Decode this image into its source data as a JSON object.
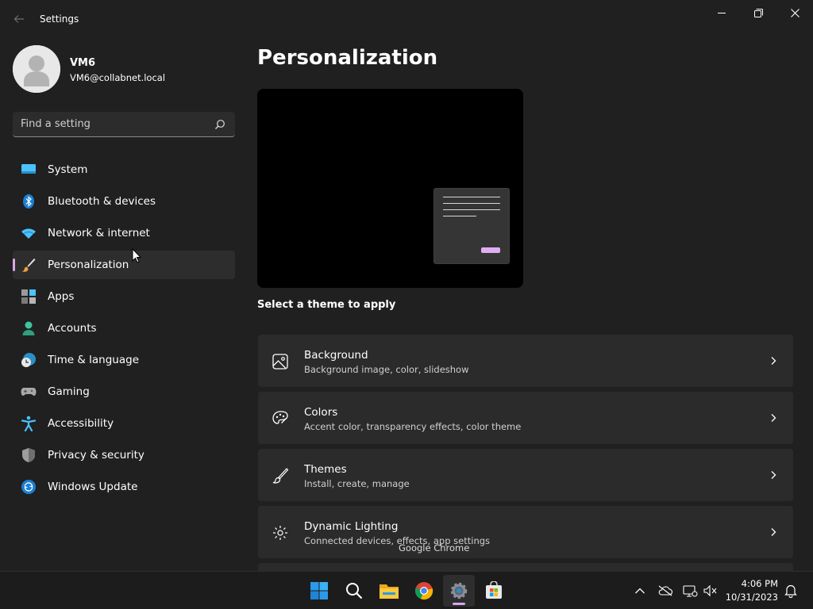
{
  "window": {
    "title": "Settings",
    "back_icon": "back-arrow-icon",
    "controls": [
      "minimize",
      "restore",
      "close"
    ]
  },
  "profile": {
    "name": "VM6",
    "email": "VM6@collabnet.local"
  },
  "search": {
    "placeholder": "Find a setting",
    "value": ""
  },
  "sidebar": {
    "items": [
      {
        "label": "System",
        "icon": "monitor-icon",
        "active": false
      },
      {
        "label": "Bluetooth & devices",
        "icon": "bluetooth-icon",
        "active": false
      },
      {
        "label": "Network & internet",
        "icon": "wifi-icon",
        "active": false
      },
      {
        "label": "Personalization",
        "icon": "paintbrush-icon",
        "active": true
      },
      {
        "label": "Apps",
        "icon": "apps-icon",
        "active": false
      },
      {
        "label": "Accounts",
        "icon": "person-icon",
        "active": false
      },
      {
        "label": "Time & language",
        "icon": "globe-clock-icon",
        "active": false
      },
      {
        "label": "Gaming",
        "icon": "gamepad-icon",
        "active": false
      },
      {
        "label": "Accessibility",
        "icon": "accessibility-icon",
        "active": false
      },
      {
        "label": "Privacy & security",
        "icon": "shield-icon",
        "active": false
      },
      {
        "label": "Windows Update",
        "icon": "update-icon",
        "active": false
      }
    ],
    "accent_color": "#d9a5eb"
  },
  "main": {
    "title": "Personalization",
    "theme_caption": "Select a theme to apply",
    "cards": [
      {
        "title": "Background",
        "subtitle": "Background image, color, slideshow",
        "icon": "image-icon"
      },
      {
        "title": "Colors",
        "subtitle": "Accent color, transparency effects, color theme",
        "icon": "palette-icon"
      },
      {
        "title": "Themes",
        "subtitle": "Install, create, manage",
        "icon": "brush-icon"
      },
      {
        "title": "Dynamic Lighting",
        "subtitle": "Connected devices, effects, app settings",
        "icon": "lighting-icon"
      }
    ]
  },
  "tooltip": "Google Chrome",
  "taskbar": {
    "apps": [
      {
        "name": "Start",
        "icon": "windows-start-icon"
      },
      {
        "name": "Search",
        "icon": "search-icon"
      },
      {
        "name": "File Explorer",
        "icon": "folder-icon"
      },
      {
        "name": "Google Chrome",
        "icon": "chrome-icon"
      },
      {
        "name": "Settings",
        "icon": "settings-gear-icon",
        "active": true
      },
      {
        "name": "Microsoft Store",
        "icon": "store-icon"
      }
    ],
    "clock": {
      "time": "4:06 PM",
      "date": "10/31/2023"
    }
  },
  "colors": {
    "background": "#202020",
    "card": "#2b2b2b",
    "accent": "#d9a5eb"
  }
}
